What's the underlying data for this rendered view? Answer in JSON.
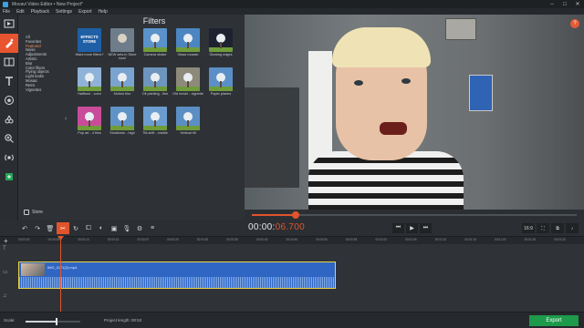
{
  "window": {
    "title": "Movavi Video Editor • New Project*"
  },
  "menu": [
    "File",
    "Edit",
    "Playback",
    "Settings",
    "Export",
    "Help"
  ],
  "tools": [
    {
      "name": "import-icon",
      "active": false
    },
    {
      "name": "filters-icon",
      "active": true
    },
    {
      "name": "transitions-icon",
      "active": false
    },
    {
      "name": "titles-icon",
      "active": false
    },
    {
      "name": "stickers-icon",
      "active": false
    },
    {
      "name": "callouts-icon",
      "active": false
    },
    {
      "name": "zoom-icon",
      "active": false
    },
    {
      "name": "stabilization-icon",
      "active": false
    },
    {
      "name": "more-tools-icon",
      "active": false
    }
  ],
  "categories": {
    "items": [
      "All",
      "Favorites",
      "Featured",
      "Noise",
      "Adjustments",
      "Artistic",
      "Blur",
      "Color filters",
      "Flying objects",
      "Light leaks",
      "Mosaic",
      "Retro",
      "Vignettes"
    ],
    "selected": "Featured",
    "store_label": "Store"
  },
  "filters": {
    "title": "Filters",
    "tiles": [
      {
        "label": "Want more filters?",
        "kind": "store",
        "line1": "EFFECTS",
        "line2": "STORE",
        "color": "#1f5fa6"
      },
      {
        "label": "NEW sets in Store now!",
        "kind": "image",
        "color": "#6f7d8a"
      },
      {
        "label": "Camera shake",
        "kind": "tree",
        "color": "#5b92c9"
      },
      {
        "label": "Glass mosaic",
        "kind": "tree",
        "color": "#4c86c2"
      },
      {
        "label": "Glowing edges",
        "kind": "tree",
        "color": "#1e2230"
      },
      {
        "label": "Halftone - color",
        "kind": "tree",
        "color": "#8fb3d8"
      },
      {
        "label": "Motion blur",
        "kind": "tree",
        "color": "#7aa3cf"
      },
      {
        "label": "Oil painting - fine",
        "kind": "tree",
        "color": "#6d95be"
      },
      {
        "label": "Old movie - vignette",
        "kind": "tree",
        "color": "#8e8a7b"
      },
      {
        "label": "Paper planes",
        "kind": "tree",
        "color": "#5b8fc7"
      },
      {
        "label": "Pop art - 4 tiles",
        "kind": "tree",
        "color": "#c94c9a"
      },
      {
        "label": "Shutdown - high",
        "kind": "tree",
        "color": "#5f93c8"
      },
      {
        "label": "Tilt-shift - middle",
        "kind": "tree",
        "color": "#6c9dd0"
      },
      {
        "label": "Vertical tilt",
        "kind": "tree",
        "color": "#5b8ec4"
      }
    ]
  },
  "player": {
    "timecode_main": "00:00:",
    "timecode_frac": "06.700",
    "progress": 0.135,
    "transport": [
      "prev-icon",
      "play-icon",
      "next-icon"
    ],
    "aspect_label": "16:9",
    "right_controls": [
      "fullscreen-icon",
      "detach-icon",
      "volume-icon"
    ]
  },
  "edit_tools": [
    "undo-icon",
    "redo-icon",
    "delete-icon",
    "cut-icon",
    "rotate-icon",
    "crop-icon",
    "color-icon",
    "transition-icon",
    "mic-icon",
    "settings-icon",
    "equalizer-icon"
  ],
  "ruler": {
    "ticks": [
      "00:00:00",
      "00:00:05",
      "00:00:10",
      "00:00:15",
      "00:00:20",
      "00:00:25",
      "00:00:30",
      "00:00:35",
      "00:00:40",
      "00:00:45",
      "00:00:50",
      "00:00:55",
      "00:01:00",
      "00:01:05",
      "00:01:10",
      "00:01:15",
      "00:01:20",
      "00:01:25",
      "00:01:30"
    ]
  },
  "timeline": {
    "clip_name": "IMG_1171(2).mp4"
  },
  "status": {
    "scale_label": "Scale:",
    "scale_value": 0.55,
    "project_length": "Project length: 00:52",
    "export_label": "Export"
  }
}
